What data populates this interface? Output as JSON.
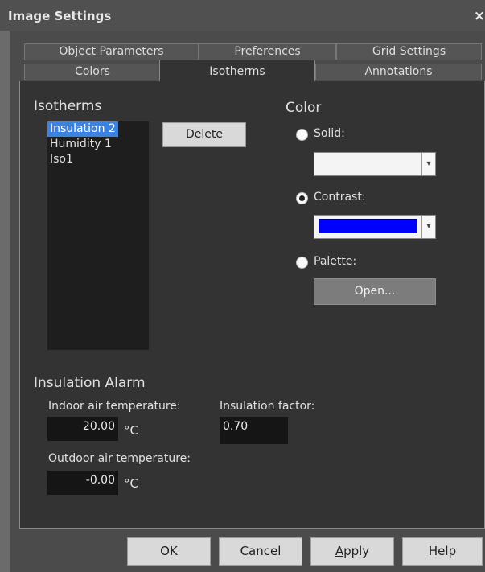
{
  "window": {
    "title": "Image Settings",
    "close_glyph": "×"
  },
  "tabs": {
    "row1": [
      "Object Parameters",
      "Preferences",
      "Grid Settings"
    ],
    "row2": [
      "Colors",
      "Isotherms",
      "Annotations"
    ],
    "active": "Isotherms"
  },
  "isotherms": {
    "title": "Isotherms",
    "items": [
      "Insulation 2",
      "Humidity 1",
      "Iso1"
    ],
    "selected": "Insulation 2",
    "delete_label": "Delete"
  },
  "color": {
    "title": "Color",
    "solid_label": "Solid:",
    "contrast_label": "Contrast:",
    "palette_label": "Palette:",
    "open_label": "Open...",
    "selected_mode": "contrast",
    "contrast_color": "#0000ff",
    "dropdown_arrow": "▾"
  },
  "insulation_alarm": {
    "title": "Insulation Alarm",
    "indoor_label": "Indoor air temperature:",
    "indoor_value": "20.00",
    "outdoor_label": "Outdoor air temperature:",
    "outdoor_value": "-0.00",
    "factor_label": "Insulation factor:",
    "factor_value": "0.70",
    "unit": "°C"
  },
  "buttons": {
    "ok": "OK",
    "cancel": "Cancel",
    "apply_first": "A",
    "apply_rest": "pply",
    "help": "Help"
  }
}
